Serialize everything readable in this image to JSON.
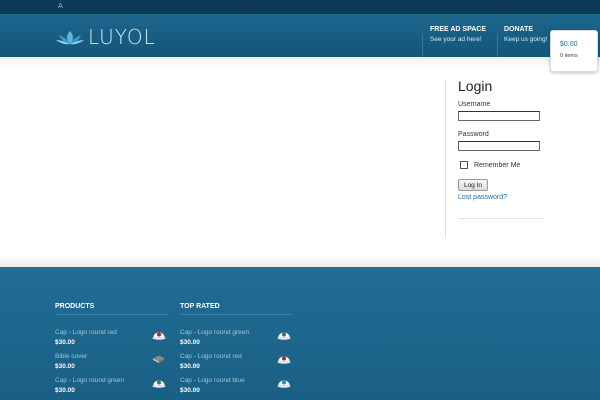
{
  "topbar": {
    "link": "A"
  },
  "header": {
    "brand": "LUYOL",
    "nav": [
      {
        "title": "FREE AD SPACE",
        "subtitle": "See your ad here!"
      },
      {
        "title": "DONATE",
        "subtitle": "Keep us going!"
      }
    ]
  },
  "cart": {
    "total": "$0.00",
    "items": "0 items"
  },
  "login": {
    "title": "Login",
    "username_label": "Username",
    "password_label": "Password",
    "remember_label": "Remember Me",
    "button": "Log In",
    "lost_password": "Lost password?"
  },
  "footer": {
    "products": {
      "title": "PRODUCTS",
      "items": [
        {
          "name": "Cap - Logo round red",
          "price": "$30.00",
          "icon": "cap-red-icon"
        },
        {
          "name": "Bible cover",
          "price": "$30.00",
          "icon": "book-icon"
        },
        {
          "name": "Cap - Logo round green",
          "price": "$30.00",
          "icon": "cap-green-icon"
        }
      ]
    },
    "top_rated": {
      "title": "TOP RATED",
      "items": [
        {
          "name": "Cap - Logo round green",
          "price": "$30.00",
          "icon": "cap-green-icon"
        },
        {
          "name": "Cap - Logo round red",
          "price": "$30.00",
          "icon": "cap-red-icon"
        },
        {
          "name": "Cap - Logo round blue",
          "price": "$30.00",
          "icon": "cap-blue-icon"
        }
      ]
    }
  },
  "colors": {
    "header": "#1a6289",
    "topbar": "#0c3a57",
    "link": "#1a6fa0",
    "footer": "#1f6a91"
  }
}
